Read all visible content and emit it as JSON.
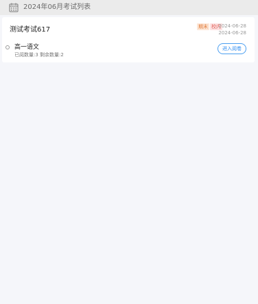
{
  "month_header": {
    "icon": "calendar-icon",
    "title": "2024年06月考试列表"
  },
  "exam": {
    "name": "测试考试617",
    "tags": [
      "期末",
      "校内"
    ],
    "start_date": "2024-06-28",
    "end_date": "2024-06-28",
    "subjects": [
      {
        "name": "高一语文",
        "stats": "已阅数量:3 剩余数量:2",
        "button_label": "进入阅卷"
      }
    ]
  },
  "colors": {
    "page_background": "#f5f6fa",
    "header_background": "#ebebeb",
    "accent": "#2d8cf0",
    "tag_term": "#e07a3a",
    "tag_school": "#e0625a"
  }
}
